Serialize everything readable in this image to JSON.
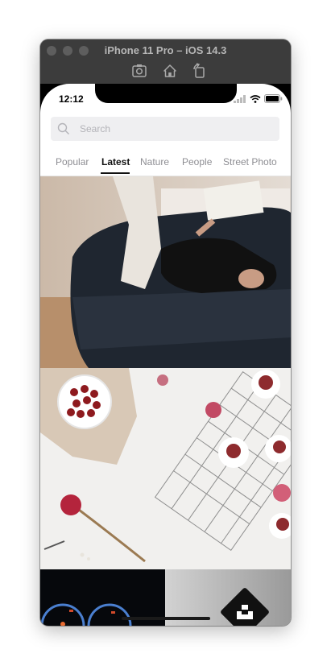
{
  "simulator": {
    "window_title": "iPhone 11 Pro – iOS 14.3",
    "toolbar_icons": [
      "screenshot-icon",
      "home-icon",
      "rotate-icon"
    ]
  },
  "status_bar": {
    "time": "12:12",
    "icons": [
      "cellular-signal-icon",
      "wifi-icon",
      "battery-icon"
    ]
  },
  "search": {
    "placeholder": "Search"
  },
  "tabs": [
    {
      "label": "Popular",
      "active": false
    },
    {
      "label": "Latest",
      "active": true
    },
    {
      "label": "Nature",
      "active": false
    },
    {
      "label": "People",
      "active": false
    },
    {
      "label": "Street Photo",
      "active": false
    }
  ],
  "photos": [
    {
      "subject": "woman reclining on dark sofa reading a newspaper"
    },
    {
      "subject": "flat lay with cherries in bowl, meringue desserts on cooling rack, flowers"
    },
    {
      "subject": "dark scene with illuminated dashboard gauges"
    },
    {
      "subject": "light grey gradient"
    }
  ],
  "fab": {
    "icon": "unsplash-logo-icon"
  },
  "colors": {
    "window_chrome": "#3a3a3a",
    "search_bg": "#efeff1",
    "tab_active": "#111111",
    "tab_inactive": "#8e8e93"
  }
}
